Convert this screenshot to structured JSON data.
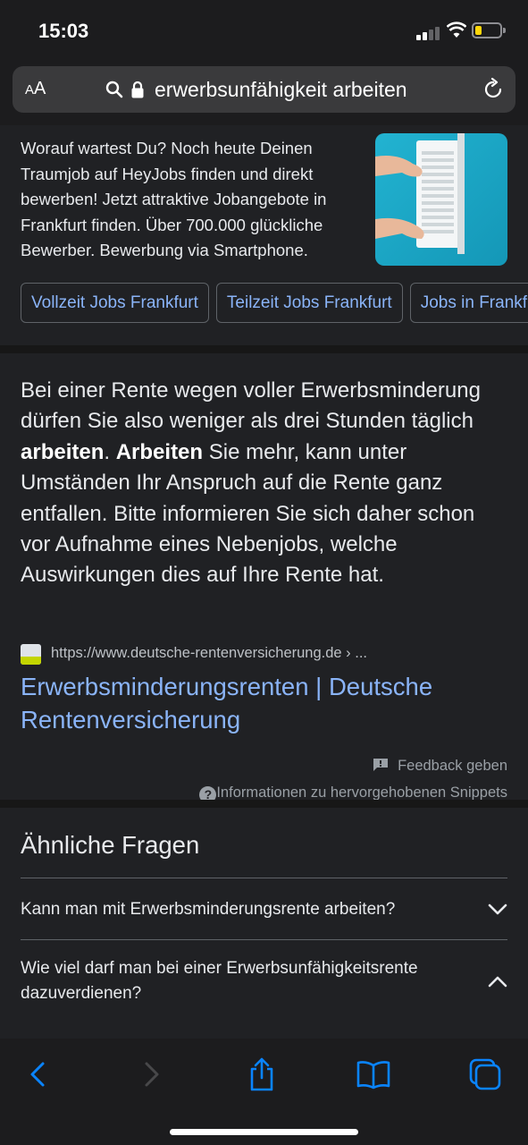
{
  "status_bar": {
    "time": "15:03",
    "battery_color": "#ffd60a"
  },
  "url_bar": {
    "text_size_label_small": "A",
    "text_size_label_large": "A",
    "url_text": "erwerbsunfähigkeit arbeiten"
  },
  "ad": {
    "description": "Worauf wartest Du? Noch heute Deinen Traumjob auf HeyJobs finden und direkt bewerben! Jetzt attraktive Jobangebote in Frankfurt finden. Über 700.000 glückliche Bewerber. Bewerbung via Smartphone.",
    "chips": [
      "Vollzeit Jobs Frankfurt",
      "Teilzeit Jobs Frankfurt",
      "Jobs in Frankfurt"
    ]
  },
  "snippet": {
    "text_part1": "Bei einer Rente wegen voller Erwerbsminderung dürfen Sie also weniger als drei Stunden täglich ",
    "bold1": "arbeiten",
    "text_part2": ". ",
    "bold2": "Arbeiten",
    "text_part3": " Sie mehr, kann unter Umständen Ihr Anspruch auf die Rente ganz entfallen. Bitte informieren Sie sich daher schon vor Aufnahme eines Nebenjobs, welche Auswirkungen dies auf Ihre Rente hat.",
    "cite_url": "https://www.deutsche-rentenversicherung.de › ...",
    "title": "Erwerbsminderungsrenten | Deutsche Rentenversicherung",
    "feedback_label": "Feedback geben",
    "info_label": "Informationen zu hervorgehobenen Snippets"
  },
  "related_questions": {
    "title": "Ähnliche Fragen",
    "items": [
      {
        "question": "Kann man mit Erwerbsminderungsrente arbeiten?",
        "expanded": false
      },
      {
        "question": "Wie viel darf man bei einer Erwerbsunfähigkeitsrente dazuverdienen?",
        "expanded": true
      }
    ]
  },
  "toolbar": {
    "icons": [
      "back-icon",
      "forward-icon",
      "share-icon",
      "bookmarks-icon",
      "tabs-icon"
    ],
    "accent": "#0a84ff"
  },
  "colors": {
    "link": "#8ab4f8",
    "background": "#202124"
  }
}
